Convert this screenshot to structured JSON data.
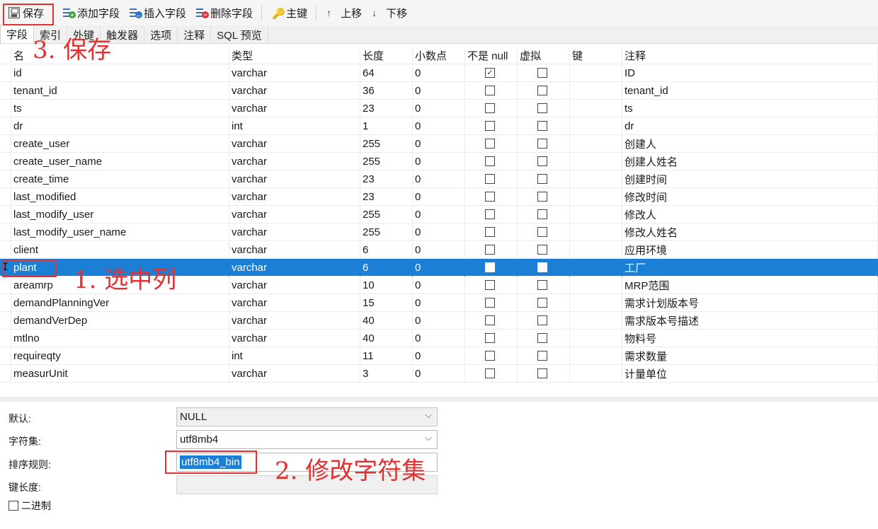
{
  "toolbar": {
    "save": "保存",
    "add_field": "添加字段",
    "insert_field": "插入字段",
    "delete_field": "删除字段",
    "primary_key": "主键",
    "move_up": "上移",
    "move_down": "下移"
  },
  "tabs": [
    "字段",
    "索引",
    "外键",
    "触发器",
    "选项",
    "注释",
    "SQL 预览"
  ],
  "columns": {
    "name": "名",
    "type": "类型",
    "length": "长度",
    "decimal": "小数点",
    "not_null": "不是 null",
    "virtual": "虚拟",
    "key": "键",
    "comment": "注释"
  },
  "fields": [
    {
      "name": "id",
      "type": "varchar",
      "length": "64",
      "decimal": "0",
      "not_null": true,
      "virtual": false,
      "comment": "ID"
    },
    {
      "name": "tenant_id",
      "type": "varchar",
      "length": "36",
      "decimal": "0",
      "not_null": false,
      "virtual": false,
      "comment": "tenant_id"
    },
    {
      "name": "ts",
      "type": "varchar",
      "length": "23",
      "decimal": "0",
      "not_null": false,
      "virtual": false,
      "comment": "ts"
    },
    {
      "name": "dr",
      "type": "int",
      "length": "1",
      "decimal": "0",
      "not_null": false,
      "virtual": false,
      "comment": "dr"
    },
    {
      "name": "create_user",
      "type": "varchar",
      "length": "255",
      "decimal": "0",
      "not_null": false,
      "virtual": false,
      "comment": "创建人"
    },
    {
      "name": "create_user_name",
      "type": "varchar",
      "length": "255",
      "decimal": "0",
      "not_null": false,
      "virtual": false,
      "comment": "创建人姓名"
    },
    {
      "name": "create_time",
      "type": "varchar",
      "length": "23",
      "decimal": "0",
      "not_null": false,
      "virtual": false,
      "comment": "创建时间"
    },
    {
      "name": "last_modified",
      "type": "varchar",
      "length": "23",
      "decimal": "0",
      "not_null": false,
      "virtual": false,
      "comment": "修改时间"
    },
    {
      "name": "last_modify_user",
      "type": "varchar",
      "length": "255",
      "decimal": "0",
      "not_null": false,
      "virtual": false,
      "comment": "修改人"
    },
    {
      "name": "last_modify_user_name",
      "type": "varchar",
      "length": "255",
      "decimal": "0",
      "not_null": false,
      "virtual": false,
      "comment": "修改人姓名"
    },
    {
      "name": "client",
      "type": "varchar",
      "length": "6",
      "decimal": "0",
      "not_null": false,
      "virtual": false,
      "comment": "应用环境"
    },
    {
      "name": "plant",
      "type": "varchar",
      "length": "6",
      "decimal": "0",
      "not_null": false,
      "virtual": false,
      "comment": "工厂",
      "selected": true
    },
    {
      "name": "areamrp",
      "type": "varchar",
      "length": "10",
      "decimal": "0",
      "not_null": false,
      "virtual": false,
      "comment": "MRP范围"
    },
    {
      "name": "demandPlanningVer",
      "type": "varchar",
      "length": "15",
      "decimal": "0",
      "not_null": false,
      "virtual": false,
      "comment": "需求计划版本号"
    },
    {
      "name": "demandVerDep",
      "type": "varchar",
      "length": "40",
      "decimal": "0",
      "not_null": false,
      "virtual": false,
      "comment": "需求版本号描述"
    },
    {
      "name": "mtlno",
      "type": "varchar",
      "length": "40",
      "decimal": "0",
      "not_null": false,
      "virtual": false,
      "comment": "物料号"
    },
    {
      "name": "requireqty",
      "type": "int",
      "length": "11",
      "decimal": "0",
      "not_null": false,
      "virtual": false,
      "comment": "需求数量"
    },
    {
      "name": "measurUnit",
      "type": "varchar",
      "length": "3",
      "decimal": "0",
      "not_null": false,
      "virtual": false,
      "comment": "计量单位"
    }
  ],
  "props": {
    "default_label": "默认:",
    "default_value": "NULL",
    "charset_label": "字符集:",
    "charset_value": "utf8mb4",
    "collation_label": "排序规则:",
    "collation_value": "utf8mb4_bin",
    "keylen_label": "键长度:",
    "keylen_value": "",
    "binary_label": "二进制"
  },
  "annotations": {
    "step1": "1. 选中列",
    "step2": "2. 修改字符集",
    "step3": "3. 保存"
  },
  "colors": {
    "selection": "#1b7fd6",
    "annotation": "#e53030"
  }
}
